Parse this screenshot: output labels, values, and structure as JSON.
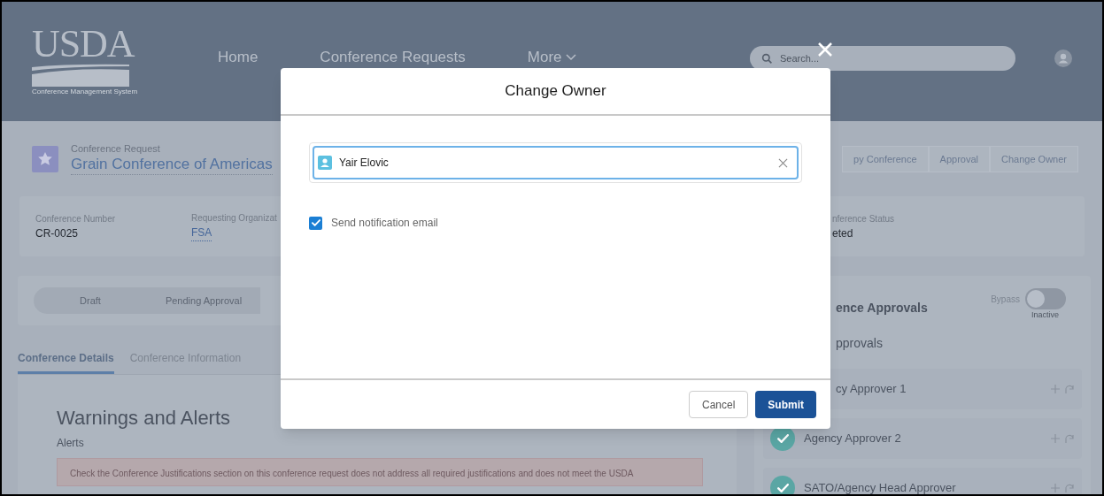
{
  "header": {
    "logo": {
      "title": "USDA",
      "subtitle": "Conference Management System"
    },
    "nav": [
      {
        "label": "Home",
        "menu": false
      },
      {
        "label": "Conference Requests",
        "menu": false
      },
      {
        "label": "More",
        "menu": true
      }
    ],
    "search": {
      "placeholder": "Search..."
    }
  },
  "record": {
    "type": "Conference Request",
    "name": "Grain Conference of Americas",
    "actions": [
      "py Conference",
      "Approval",
      "Change Owner"
    ]
  },
  "fields": [
    {
      "label": "Conference Number",
      "value": "CR-0025",
      "kind": "text"
    },
    {
      "label": "Requesting Organizat",
      "value": "FSA",
      "kind": "link"
    },
    {
      "label": "nference Status",
      "value": "eted",
      "kind": "text"
    }
  ],
  "path": [
    {
      "label": "Draft"
    },
    {
      "label": "Pending Approval"
    }
  ],
  "tabs": [
    {
      "label": "Conference Details",
      "selected": true
    },
    {
      "label": "Conference Information",
      "selected": false
    }
  ],
  "warnings": {
    "title": "Warnings and Alerts",
    "subtitle": "Alerts",
    "alert": "Check the Conference Justifications section on this conference request does not address all required justifications and does not meet the USDA"
  },
  "approvals": {
    "title": "ence Approvals",
    "bypass": {
      "label": "Bypass",
      "on": false,
      "status": "Inactive"
    },
    "subtitle": "pprovals",
    "approvers": [
      {
        "name": "cy Approver 1"
      },
      {
        "name": "Agency Approver 2",
        "approved": true
      },
      {
        "name": "SATO/Agency Head Approver",
        "approved": true
      }
    ]
  },
  "modal": {
    "title": "Change Owner",
    "owner": {
      "value": "Yair Elovic"
    },
    "notify": {
      "label": "Send notification email",
      "checked": true
    },
    "buttons": [
      {
        "label": "Cancel",
        "kind": "secondary"
      },
      {
        "label": "Submit",
        "kind": "primary"
      }
    ]
  }
}
